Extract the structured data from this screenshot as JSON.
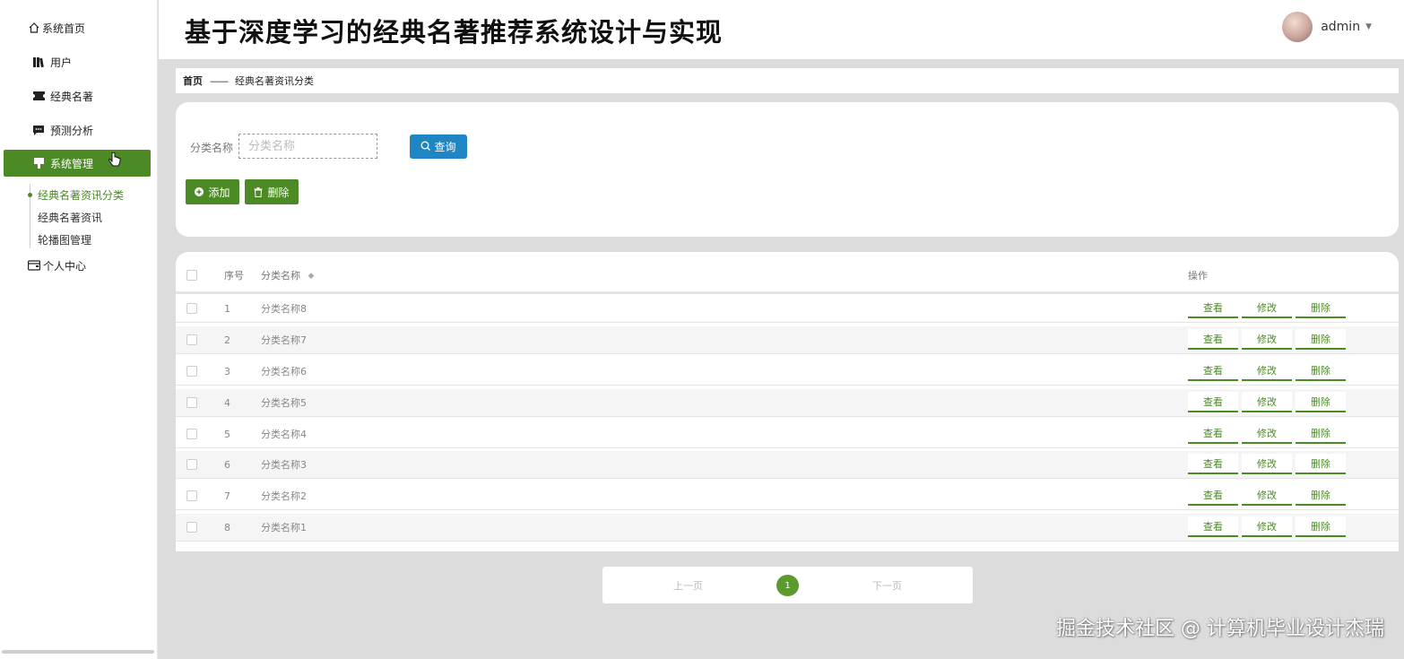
{
  "sidebar": {
    "home": "系统首页",
    "items": [
      {
        "label": "用户",
        "icon": "book-icon"
      },
      {
        "label": "经典名著",
        "icon": "ticket-icon"
      },
      {
        "label": "预测分析",
        "icon": "chat-icon"
      },
      {
        "label": "系统管理",
        "icon": "cup-icon"
      }
    ],
    "sub_items": [
      "经典名著资讯分类",
      "经典名著资讯",
      "轮播图管理"
    ],
    "personal": "个人中心"
  },
  "header": {
    "title": "基于深度学习的经典名著推荐系统设计与实现",
    "username": "admin"
  },
  "breadcrumb": {
    "home": "首页",
    "separator": "——",
    "current": "经典名著资讯分类"
  },
  "search": {
    "label": "分类名称",
    "placeholder": "分类名称",
    "query_label": "查询",
    "add_label": "添加",
    "delete_label": "删除"
  },
  "table": {
    "headers": {
      "index": "序号",
      "name": "分类名称",
      "ops": "操作"
    },
    "rows": [
      {
        "index": "1",
        "name": "分类名称8"
      },
      {
        "index": "2",
        "name": "分类名称7"
      },
      {
        "index": "3",
        "name": "分类名称6"
      },
      {
        "index": "4",
        "name": "分类名称5"
      },
      {
        "index": "5",
        "name": "分类名称4"
      },
      {
        "index": "6",
        "name": "分类名称3"
      },
      {
        "index": "7",
        "name": "分类名称2"
      },
      {
        "index": "8",
        "name": "分类名称1"
      }
    ],
    "ops": {
      "view": "查看",
      "edit": "修改",
      "delete": "删除"
    }
  },
  "pager": {
    "prev": "上一页",
    "page": "1",
    "next": "下一页"
  },
  "watermark": "掘金技术社区 @ 计算机毕业设计杰瑞",
  "colors": {
    "accent": "#4b8a25",
    "query": "#1f86c3"
  }
}
